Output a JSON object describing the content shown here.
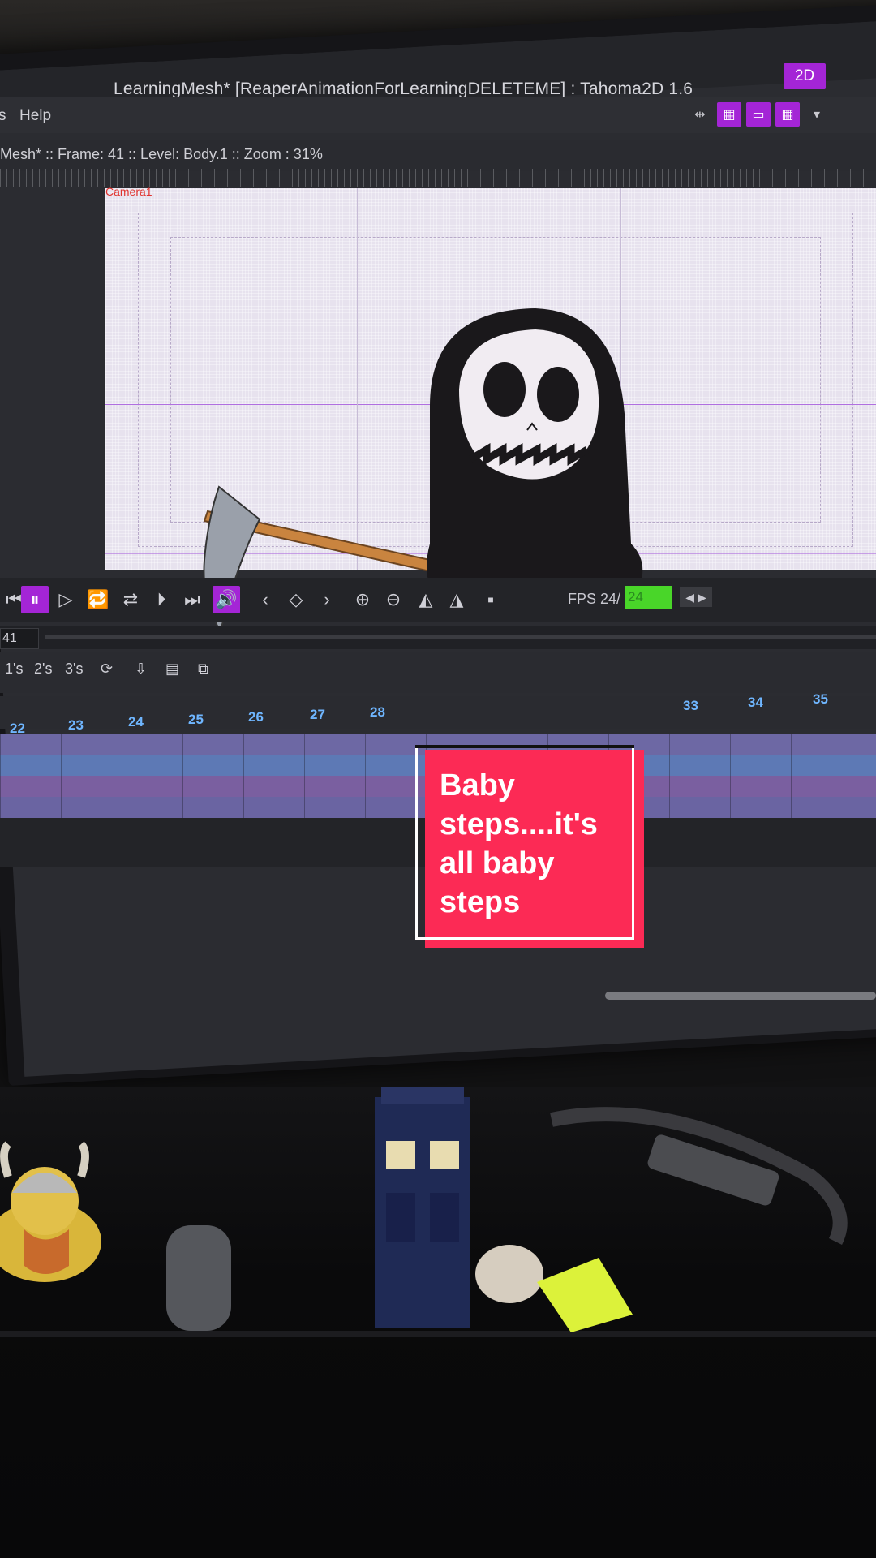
{
  "window": {
    "title": "LearningMesh* [ReaperAnimationForLearningDELETEME] : Tahoma2D 1.6",
    "mode_button": "2D"
  },
  "menu": {
    "prev_fragment": "s",
    "help": "Help"
  },
  "viewer": {
    "status": "Mesh*  ::  Frame: 41  ::  Level: Body.1  ::  Zoom : 31%",
    "camera_label": "Camera1"
  },
  "playback": {
    "fps_label": "FPS 24/",
    "fps_value": "24",
    "current_frame": "41"
  },
  "tools": {
    "step1": "1's",
    "step2": "2's",
    "step3": "3's"
  },
  "timeline": {
    "frame_numbers_left": [
      "22",
      "23",
      "24",
      "25",
      "26",
      "27",
      "28"
    ],
    "frame_numbers_right": [
      "33",
      "34",
      "35"
    ]
  },
  "caption": {
    "text": "Baby\nsteps....it's\nall baby\nsteps"
  },
  "colors": {
    "accent": "#a425d6",
    "fps_green": "#49d629",
    "caption_red": "#fc2a55"
  }
}
